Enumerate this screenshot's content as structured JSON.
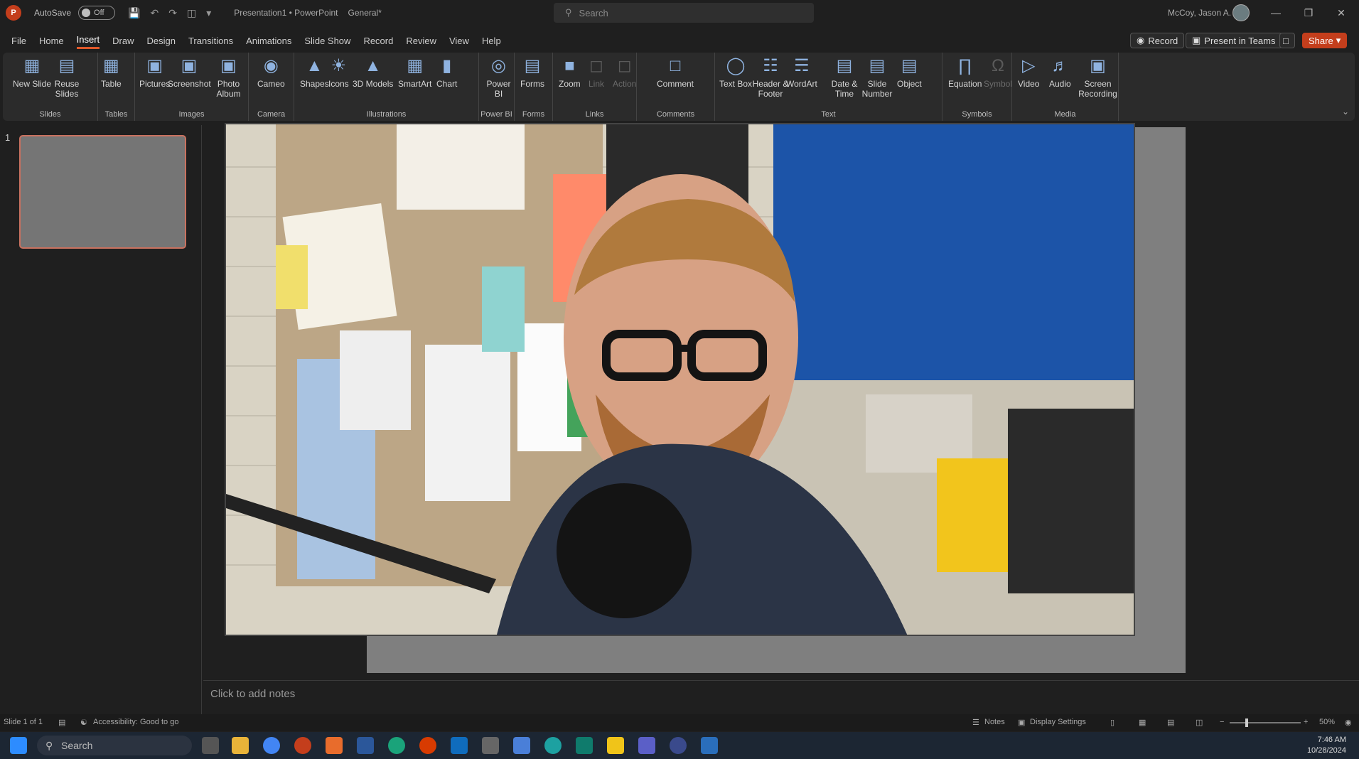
{
  "titlebar": {
    "autosave_label": "AutoSave",
    "autosave_state": "Off",
    "doc_title": "Presentation1 • PowerPoint",
    "sensitivity": "General*",
    "search_placeholder": "Search",
    "user_name": "McCoy, Jason A."
  },
  "tabs": [
    "File",
    "Home",
    "Insert",
    "Draw",
    "Design",
    "Transitions",
    "Animations",
    "Slide Show",
    "Record",
    "Review",
    "View",
    "Help"
  ],
  "active_tab": "Insert",
  "tab_buttons": {
    "record": "Record",
    "present": "Present in Teams",
    "share": "Share"
  },
  "ribbon": {
    "groups": [
      {
        "label": "Slides",
        "buttons": [
          "New Slide",
          "Reuse Slides"
        ]
      },
      {
        "label": "Tables",
        "buttons": [
          "Table"
        ]
      },
      {
        "label": "Images",
        "buttons": [
          "Pictures",
          "Screenshot",
          "Photo Album"
        ]
      },
      {
        "label": "Camera",
        "buttons": [
          "Cameo"
        ]
      },
      {
        "label": "Illustrations",
        "buttons": [
          "Shapes",
          "Icons",
          "3D Models",
          "SmartArt",
          "Chart"
        ]
      },
      {
        "label": "Power BI",
        "buttons": [
          "Power BI"
        ]
      },
      {
        "label": "Forms",
        "buttons": [
          "Forms"
        ]
      },
      {
        "label": "Links",
        "buttons": [
          "Zoom",
          "Link",
          "Action"
        ]
      },
      {
        "label": "Comments",
        "buttons": [
          "Comment"
        ]
      },
      {
        "label": "Text",
        "buttons": [
          "Text Box",
          "Header & Footer",
          "WordArt",
          "Date & Time",
          "Slide Number",
          "Object"
        ]
      },
      {
        "label": "Symbols",
        "buttons": [
          "Equation",
          "Symbol"
        ]
      },
      {
        "label": "Media",
        "buttons": [
          "Video",
          "Audio",
          "Screen Recording"
        ]
      }
    ]
  },
  "thumbnails": {
    "number": "1"
  },
  "notes_placeholder": "Click to add notes",
  "status": {
    "slide_info": "Slide 1 of 1",
    "accessibility": "Accessibility: Good to go",
    "notes": "Notes",
    "display_settings": "Display Settings",
    "zoom": "50%"
  },
  "taskbar": {
    "search": "Search",
    "time": "7:46 AM",
    "date": "10/28/2024"
  }
}
